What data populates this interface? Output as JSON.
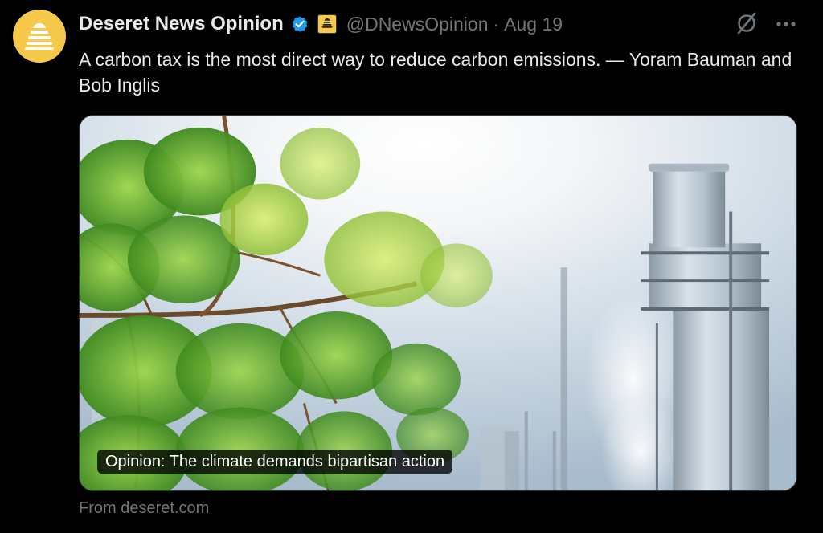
{
  "tweet": {
    "display_name": "Deseret News Opinion",
    "handle": "@DNewsOpinion",
    "separator": "·",
    "timestamp": "Aug 19",
    "text": "A carbon tax is the most direct way to reduce carbon emissions. — Yoram Bauman and Bob Inglis",
    "verified_color": "#1d9bf0",
    "avatar_color": "#f6c94a"
  },
  "card": {
    "title": "Opinion: The climate demands bipartisan action",
    "source": "From deseret.com",
    "image": "tree-and-industrial-smokestack-photo"
  },
  "icons": {
    "verified": "verified-badge-icon",
    "affiliate": "beehive-badge-icon",
    "grok": "grok-icon",
    "more": "more-dots-icon"
  }
}
